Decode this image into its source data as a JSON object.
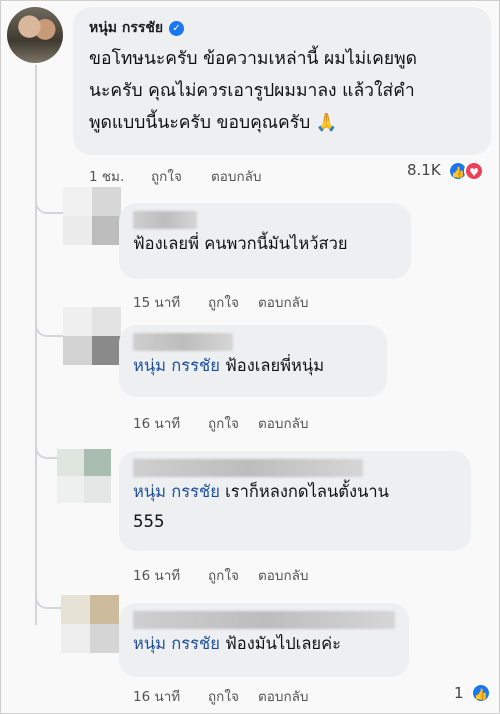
{
  "main_comment": {
    "author": "หนุ่ม กรรชัย",
    "verified_icon": "verified-badge-icon",
    "text_lines": [
      "ขอโทษนะครับ ข้อความเหล่านี้ ผมไม่เคยพูด",
      "นะครับ คุณไม่ควรเอารูปผมมาลง แล้วใส่คำ",
      "พูดแบบนี้นะครับ ขอบคุณครับ 🙏"
    ],
    "time": "1 ชม.",
    "like_label": "ถูกใจ",
    "reply_label": "ตอบกลับ",
    "reaction_count": "8.1K",
    "reaction_icons": [
      "like-icon",
      "love-icon"
    ]
  },
  "replies": [
    {
      "tag": "",
      "text": "ฟ้องเลยพี่ คนพวกนี้มันไหว้สวย",
      "time": "15 นาที",
      "like_label": "ถูกใจ",
      "reply_label": "ตอบกลับ"
    },
    {
      "tag": "หนุ่ม กรรชัย",
      "text": "ฟ้องเลยพี่หนุ่ม",
      "time": "16 นาที",
      "like_label": "ถูกใจ",
      "reply_label": "ตอบกลับ"
    },
    {
      "tag": "หนุ่ม กรรชัย",
      "text": "เราก็หลงกดไลนตั้งนาน",
      "text2": "555",
      "time": "16 นาที",
      "like_label": "ถูกใจ",
      "reply_label": "ตอบกลับ"
    },
    {
      "tag": "หนุ่ม กรรชัย",
      "text": "ฟ้องมันไปเลยค่ะ",
      "time": "16 นาที",
      "like_label": "ถูกใจ",
      "reply_label": "ตอบกลับ",
      "reaction_count": "1"
    }
  ],
  "colors": {
    "bubble": "#eeeff1",
    "tag": "#1d4fa0",
    "like_blue": "#1877f2",
    "love_red": "#f33e58"
  }
}
